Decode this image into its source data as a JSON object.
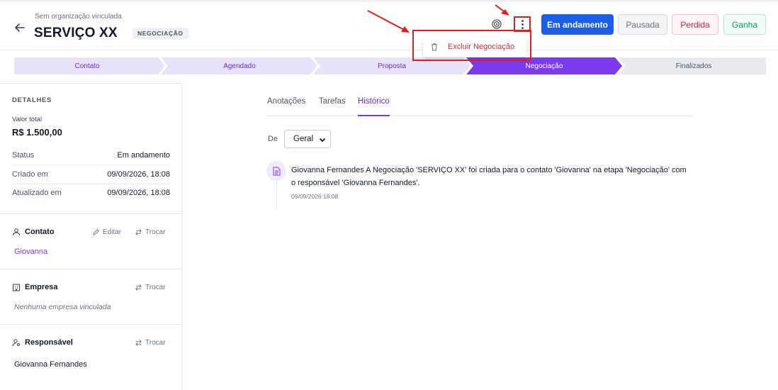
{
  "header": {
    "org_label": "Sem organização vinculada",
    "title": "SERVIÇO XX",
    "stage_tag": "NEGOCIAÇÃO",
    "icons": {
      "back": "arrow-left-icon",
      "target": "target-icon",
      "more": "more-vertical-icon"
    },
    "buttons": {
      "in_progress": "Em andamento",
      "paused": "Pausada",
      "lost": "Perdida",
      "won": "Ganha"
    }
  },
  "menu": {
    "delete_label": "Excluir Negociação",
    "icon": "trash-icon"
  },
  "pipeline": {
    "stages": [
      "Contato",
      "Agendado",
      "Proposta",
      "Negociação",
      "Finalizados"
    ],
    "active_index": 3
  },
  "sidebar": {
    "details": {
      "heading": "DETALHES",
      "total_label": "Valor total",
      "total_value": "R$ 1.500,00",
      "rows": [
        {
          "label": "Status",
          "value": "Em andamento"
        },
        {
          "label": "Criado em",
          "value": "09/09/2026, 18:08"
        },
        {
          "label": "Atualizado em",
          "value": "09/09/2026, 18:08"
        }
      ]
    },
    "contact": {
      "heading": "Contato",
      "edit": "Editar",
      "swap": "Trocar",
      "name": "Giovanna"
    },
    "company": {
      "heading": "Empresa",
      "swap": "Trocar",
      "empty": "Nenhuma empresa vinculada"
    },
    "owner": {
      "heading": "Responsável",
      "swap": "Trocar",
      "name": "Giovanna Fernandes"
    }
  },
  "main": {
    "tabs": [
      "Anotações",
      "Tarefas",
      "Histórico"
    ],
    "active_tab": 2,
    "filter": {
      "label": "De",
      "value": "Geral"
    },
    "events": [
      {
        "text": "Giovanna Fernandes A Negociação 'SERVIÇO XX' foi criada para o contato 'Giovanna' na etapa 'Negociação' com o responsável 'Giovanna Fernandes'.",
        "time": "09/09/2026 18:08",
        "icon": "document-icon"
      }
    ]
  },
  "colors": {
    "primary": "#1d5ee6",
    "accent": "#7c3aed",
    "stage_done": "#e9e2fb",
    "stage_active": "#7c3aed",
    "stage_todo": "#e8eaed",
    "annotation": "#e01e1e"
  }
}
